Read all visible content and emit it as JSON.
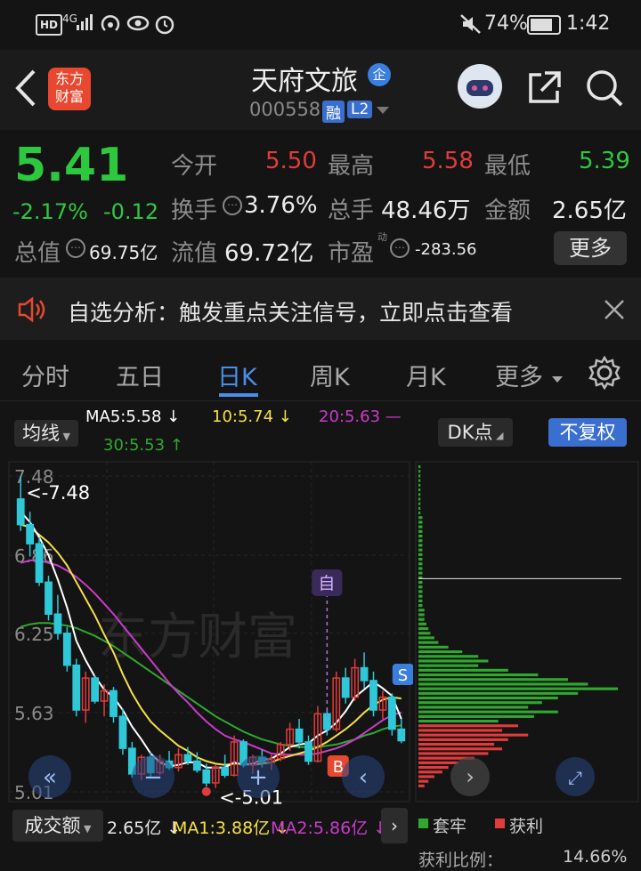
{
  "status_bar": {
    "left_badges": "HD 4G",
    "battery": "74%",
    "time": "1:42"
  },
  "header": {
    "app_logo_text": "东方\n财富",
    "stock_name": "天府文旅",
    "enterprise_badge": "企",
    "stock_code": "000558",
    "margin_badge": "融",
    "level_badge": "L2"
  },
  "quote": {
    "price": "5.41",
    "change_pct": "-2.17%",
    "change_abs": "-0.12",
    "open_label": "今开",
    "open_value": "5.50",
    "high_label": "最高",
    "high_value": "5.58",
    "low_label": "最低",
    "low_value": "5.39",
    "turnover_label": "换手",
    "turnover_value": "3.76%",
    "volume_label": "总手",
    "volume_value": "48.46万",
    "amount_label": "金额",
    "amount_value": "2.65亿",
    "mktcap_label": "总值",
    "mktcap_value": "69.75亿",
    "float_label": "流值",
    "float_value": "69.72亿",
    "pe_label": "市盈",
    "pe_sup": "动",
    "pe_value": "-283.56",
    "more_button": "更多"
  },
  "notice": {
    "text": "自选分析：触发重点关注信号，立即点击查看"
  },
  "tabs": [
    "分时",
    "五日",
    "日K",
    "周K",
    "月K",
    "更多"
  ],
  "active_tab": "日K",
  "indicators": {
    "ma_selector": "均线",
    "ma5": "MA5:5.58 ↓",
    "ma10": "10:5.74 ↓",
    "ma20": "20:5.63 —",
    "ma30": "30:5.53 ↑",
    "dk_button": "DK点",
    "adjust_button": "不复权"
  },
  "chart_data": {
    "type": "candlestick",
    "y_ticks": [
      "7.48",
      "6.86",
      "6.25",
      "5.63",
      "5.01"
    ],
    "ylim": [
      5.01,
      7.48
    ],
    "high_annotation": "<-7.48",
    "low_annotation": "<-5.01",
    "markers": {
      "self_select": "自",
      "buy": "B",
      "sell": "S"
    },
    "watermark": "东方财富",
    "colors": {
      "up": "#e23b3b",
      "down": "#2ec8d8",
      "ma5": "#ffffff",
      "ma10": "#f5e04a",
      "ma20": "#c83cc8",
      "ma30": "#2fa82f"
    },
    "candles": [
      [
        7.3,
        7.48,
        7.05,
        7.1
      ],
      [
        7.1,
        7.2,
        6.85,
        6.95
      ],
      [
        6.95,
        7.0,
        6.62,
        6.65
      ],
      [
        6.65,
        6.7,
        6.35,
        6.4
      ],
      [
        6.4,
        6.55,
        6.2,
        6.25
      ],
      [
        6.25,
        6.3,
        5.95,
        6.0
      ],
      [
        6.0,
        6.05,
        5.6,
        5.65
      ],
      [
        5.65,
        5.95,
        5.55,
        5.9
      ],
      [
        5.9,
        5.92,
        5.7,
        5.72
      ],
      [
        5.72,
        5.85,
        5.6,
        5.8
      ],
      [
        5.8,
        5.83,
        5.55,
        5.6
      ],
      [
        5.6,
        5.66,
        5.3,
        5.35
      ],
      [
        5.35,
        5.4,
        5.12,
        5.15
      ],
      [
        5.15,
        5.3,
        5.1,
        5.28
      ],
      [
        5.28,
        5.32,
        5.12,
        5.16
      ],
      [
        5.16,
        5.3,
        5.14,
        5.25
      ],
      [
        5.25,
        5.33,
        5.18,
        5.2
      ],
      [
        5.2,
        5.35,
        5.17,
        5.3
      ],
      [
        5.3,
        5.36,
        5.22,
        5.25
      ],
      [
        5.25,
        5.32,
        5.16,
        5.18
      ],
      [
        5.18,
        5.23,
        5.05,
        5.08
      ],
      [
        5.08,
        5.22,
        5.04,
        5.2
      ],
      [
        5.2,
        5.3,
        5.12,
        5.14
      ],
      [
        5.14,
        5.45,
        5.13,
        5.4
      ],
      [
        5.4,
        5.42,
        5.2,
        5.22
      ],
      [
        5.22,
        5.3,
        5.15,
        5.28
      ],
      [
        5.28,
        5.34,
        5.2,
        5.24
      ],
      [
        5.24,
        5.3,
        5.18,
        5.27
      ],
      [
        5.27,
        5.4,
        5.25,
        5.38
      ],
      [
        5.38,
        5.55,
        5.33,
        5.5
      ],
      [
        5.5,
        5.58,
        5.35,
        5.4
      ],
      [
        5.4,
        5.45,
        5.22,
        5.25
      ],
      [
        5.25,
        5.68,
        5.24,
        5.62
      ],
      [
        5.62,
        5.66,
        5.45,
        5.5
      ],
      [
        5.5,
        5.95,
        5.48,
        5.9
      ],
      [
        5.9,
        5.98,
        5.7,
        5.75
      ],
      [
        5.75,
        6.05,
        5.72,
        5.98
      ],
      [
        5.98,
        6.1,
        5.82,
        5.88
      ],
      [
        5.88,
        5.95,
        5.6,
        5.65
      ],
      [
        5.65,
        5.8,
        5.58,
        5.75
      ],
      [
        5.75,
        5.78,
        5.45,
        5.5
      ],
      [
        5.5,
        5.58,
        5.39,
        5.41
      ]
    ],
    "ma5_values": [
      7.2,
      7.12,
      7.0,
      6.86,
      6.67,
      6.45,
      6.19,
      6.04,
      5.91,
      5.81,
      5.75,
      5.65,
      5.52,
      5.42,
      5.31,
      5.24,
      5.21,
      5.22,
      5.24,
      5.24,
      5.2,
      5.2,
      5.2,
      5.24,
      5.22,
      5.23,
      5.26,
      5.27,
      5.31,
      5.36,
      5.38,
      5.39,
      5.45,
      5.49,
      5.55,
      5.64,
      5.75,
      5.81,
      5.87,
      5.82,
      5.76,
      5.58
    ],
    "ma10_values": [
      7.1,
      7.08,
      7.02,
      6.96,
      6.88,
      6.78,
      6.65,
      6.52,
      6.39,
      6.24,
      6.1,
      5.93,
      5.78,
      5.66,
      5.56,
      5.49,
      5.43,
      5.37,
      5.33,
      5.28,
      5.25,
      5.23,
      5.22,
      5.23,
      5.23,
      5.22,
      5.23,
      5.24,
      5.27,
      5.29,
      5.31,
      5.33,
      5.36,
      5.4,
      5.45,
      5.5,
      5.56,
      5.63,
      5.69,
      5.73,
      5.75,
      5.74
    ],
    "ma20_values": [
      6.8,
      6.82,
      6.82,
      6.8,
      6.78,
      6.74,
      6.69,
      6.63,
      6.56,
      6.48,
      6.4,
      6.31,
      6.22,
      6.13,
      6.04,
      5.95,
      5.86,
      5.78,
      5.71,
      5.63,
      5.56,
      5.5,
      5.45,
      5.42,
      5.4,
      5.37,
      5.34,
      5.31,
      5.3,
      5.3,
      5.3,
      5.3,
      5.31,
      5.33,
      5.35,
      5.38,
      5.42,
      5.47,
      5.52,
      5.57,
      5.61,
      5.63
    ],
    "ma30_values": [
      6.3,
      6.32,
      6.33,
      6.33,
      6.32,
      6.31,
      6.29,
      6.26,
      6.23,
      6.19,
      6.15,
      6.1,
      6.05,
      6.0,
      5.95,
      5.9,
      5.85,
      5.8,
      5.75,
      5.7,
      5.65,
      5.6,
      5.56,
      5.52,
      5.48,
      5.45,
      5.42,
      5.4,
      5.38,
      5.37,
      5.36,
      5.36,
      5.36,
      5.37,
      5.38,
      5.4,
      5.42,
      5.45,
      5.47,
      5.5,
      5.52,
      5.53
    ],
    "volume_profile": {
      "trapped_label": "套牢",
      "profit_label": "获利",
      "profit_ratio_label": "获利比例：",
      "profit_ratio_value": "14.66%",
      "bars": [
        0.01,
        0.01,
        0.01,
        0.01,
        0.01,
        0.01,
        0.01,
        0.01,
        0.01,
        0.01,
        0.01,
        0.02,
        0.02,
        0.02,
        0.02,
        0.02,
        0.02,
        0.02,
        0.02,
        0.02,
        0.02,
        0.02,
        0.02,
        0.02,
        0.02,
        0.02,
        0.02,
        0.02,
        0.02,
        0.02,
        0.02,
        0.03,
        0.03,
        0.03,
        0.04,
        0.05,
        0.06,
        0.08,
        0.1,
        0.15,
        0.22,
        0.3,
        0.35,
        0.3,
        0.45,
        0.6,
        0.75,
        0.85,
        1.0,
        0.8,
        0.7,
        0.62,
        0.55,
        0.7,
        0.58,
        0.4,
        0.5,
        0.42,
        0.55,
        0.45,
        0.38,
        0.42,
        0.35,
        0.28,
        0.2,
        0.15,
        0.12,
        0.08,
        0.05,
        0.03
      ]
    }
  },
  "volume_indicator": {
    "selector": "成交额",
    "value": "2.65亿 ↓",
    "ma1": "MA1:3.88亿 ↓",
    "ma2": "MA2:5.86亿 ↓"
  }
}
